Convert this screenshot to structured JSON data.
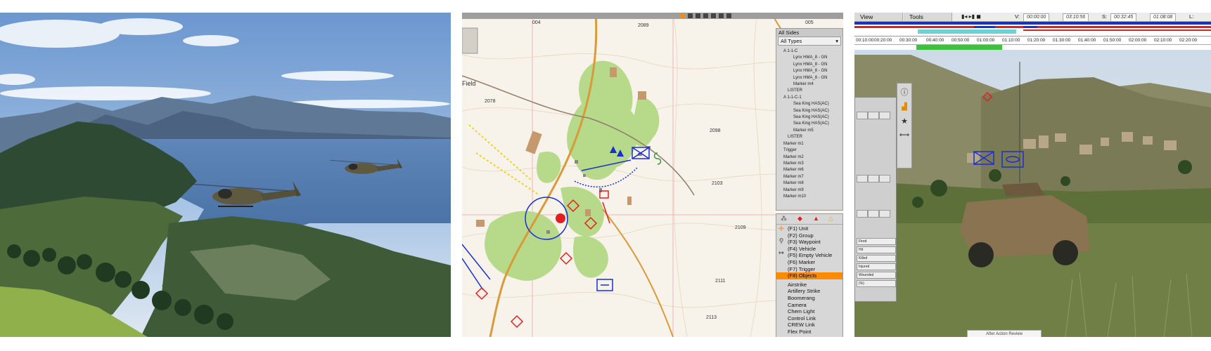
{
  "map": {
    "grid_labels": [
      "004",
      "2089",
      "005",
      "2078",
      "2098",
      "2103",
      "2109",
      "2111",
      "2113"
    ],
    "place_label": "Field",
    "filter": {
      "sides": "All Sides",
      "types": "All Types"
    },
    "tree_items": [
      "A 1-1-C",
      "Lynx HMA_8 - GN",
      "Lynx HMA_8 - GN",
      "Lynx HMA_8 - GN",
      "Lynx HMA_8 - GN",
      "Marker m4",
      "LISTER",
      "A 1-1-C-1",
      "Sea King HAS(AC)",
      "Sea King HAS(AC)",
      "Sea King HAS(AC)",
      "Sea King HAS(AC)",
      "Marker m5",
      "LISTER",
      "Marker m1",
      "Trigger",
      "Marker m2",
      "Marker m3",
      "Marker m6",
      "Marker m7",
      "Marker m8",
      "Marker m9",
      "Marker m10"
    ],
    "editor_modes": [
      "(F1) Unit",
      "(F2) Group",
      "(F3) Waypoint",
      "(F4) Vehicle",
      "(F5) Empty Vehicle",
      "(F6) Marker",
      "(F7) Trigger",
      "(F8) Objects"
    ],
    "selected_mode": "(F8) Objects",
    "objects": [
      "Airstrike",
      "Artillery Strike",
      "Boomerang",
      "Camera",
      "Chem Light",
      "Control Link",
      "CREW Link",
      "Flex Point"
    ]
  },
  "aar": {
    "menus": [
      "View",
      "Tools"
    ],
    "labels": {
      "v": "V:",
      "s": "S:",
      "l": "L:"
    },
    "values": {
      "v": "00:00:00",
      "t1": "03:10:56",
      "s": "00:32:45",
      "t2": "01:08:08"
    },
    "timeline_ticks": [
      "00:10:00",
      "00:20:00",
      "00:30:00",
      "00:40:00",
      "00:50:00",
      "01:00:00",
      "01:10:00",
      "01:20:00",
      "01:30:00",
      "01:40:00",
      "01:50:00",
      "02:00:00",
      "02:10:00",
      "02:20:00"
    ],
    "stats_rows": [
      "Fired",
      "Hit",
      "Killed",
      "Injured",
      "Wounded",
      "(%)"
    ],
    "bottom_label": "After Action Review"
  },
  "colors": {
    "selected": "#ff8a00",
    "friendly": "#1a2fd0",
    "hostile": "#e02020",
    "forest": "#b6d98a"
  }
}
